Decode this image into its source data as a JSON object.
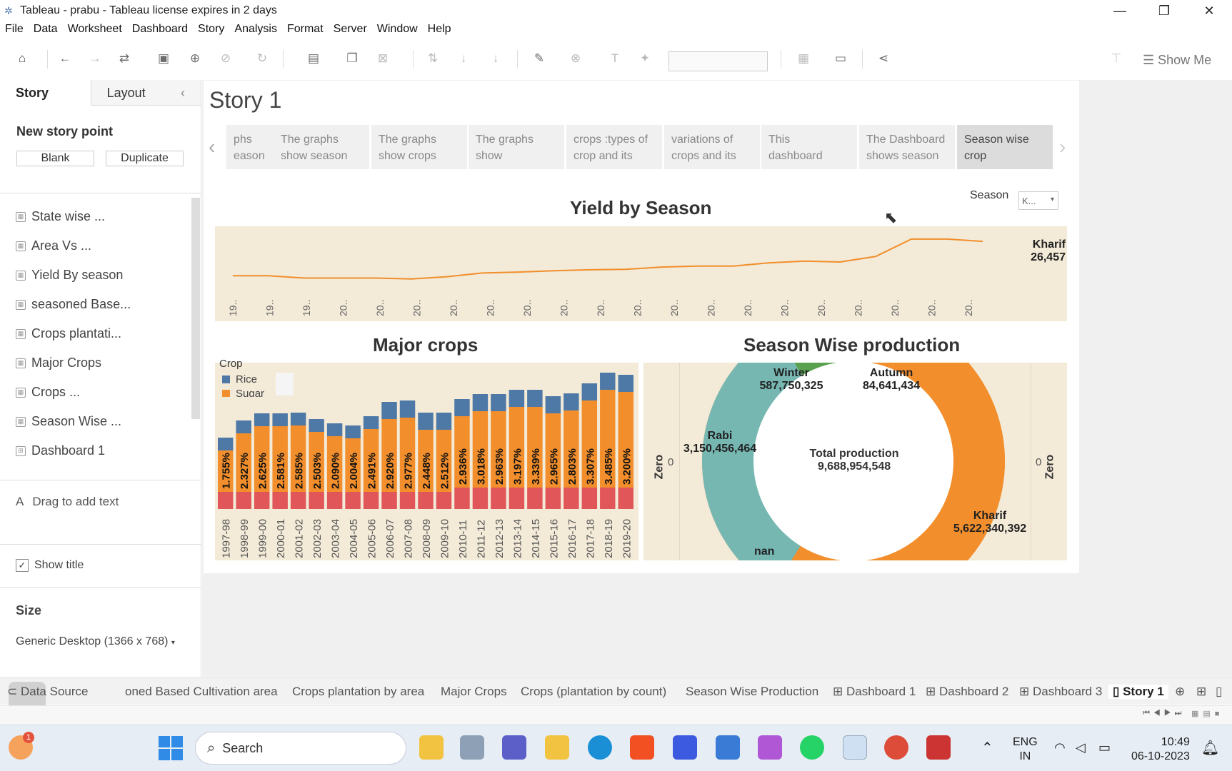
{
  "window": {
    "title": "Tableau - prabu - Tableau license expires in 2 days"
  },
  "menu": [
    "File",
    "Data",
    "Worksheet",
    "Dashboard",
    "Story",
    "Analysis",
    "Format",
    "Server",
    "Window",
    "Help"
  ],
  "toolbar": {
    "show_me": "Show Me"
  },
  "left_pane": {
    "tab_story": "Story",
    "tab_layout": "Layout",
    "new_story_point": "New story point",
    "blank": "Blank",
    "duplicate": "Duplicate",
    "sheets": [
      "State wise ...",
      "Area Vs ...",
      "Yield By season",
      "seasoned Base...",
      "Crops plantati...",
      "Major Crops",
      "Crops ...",
      "Season Wise ...",
      "Dashboard 1"
    ],
    "drag_text": "Drag to add text",
    "show_title": "Show title",
    "size_label": "Size",
    "size_value": "Generic Desktop (1366 x 768)"
  },
  "story": {
    "title": "Story 1",
    "points": [
      [
        "phs",
        "eason"
      ],
      [
        "The graphs",
        "show season"
      ],
      [
        "The graphs",
        "show crops"
      ],
      [
        "The graphs",
        "show"
      ],
      [
        "crops :types of",
        "crop and its"
      ],
      [
        "variations of",
        "crops and its"
      ],
      [
        "This",
        "dashboard"
      ],
      [
        "The Dashboard",
        "shows season"
      ],
      [
        "Season wise",
        "crop"
      ]
    ]
  },
  "filter": {
    "label": "Season",
    "value": "K..."
  },
  "yield_chart": {
    "title": "Yield by Season",
    "end_label_name": "Kharif",
    "end_label_value": "26,457",
    "x_ticks": [
      "19..",
      "19..",
      "19..",
      "20..",
      "20..",
      "20..",
      "20..",
      "20..",
      "20..",
      "20..",
      "20..",
      "20..",
      "20..",
      "20..",
      "20..",
      "20..",
      "20..",
      "20..",
      "20..",
      "20..",
      "20.."
    ]
  },
  "crops_chart": {
    "title": "Major crops",
    "legend_title": "Crop",
    "legend": [
      "Rice",
      "Sugar"
    ]
  },
  "pie_chart": {
    "title": "Season Wise production",
    "axis_label": "Zero",
    "axis_zero": "0",
    "center_title": "Total production",
    "center_value": "9,688,954,548",
    "labels": [
      {
        "name": "Winter",
        "value": "587,750,325"
      },
      {
        "name": "Autumn",
        "value": "84,641,434"
      },
      {
        "name": "Rabi",
        "value": "3,150,456,464"
      },
      {
        "name": "Kharif",
        "value": "5,622,340,392"
      },
      {
        "name": "nan",
        "value": ""
      }
    ]
  },
  "chart_data": [
    {
      "type": "line",
      "title": "Yield by Season",
      "series": [
        {
          "name": "Kharif",
          "values": [
            24400,
            24400,
            24350,
            24350,
            24350,
            24330,
            24380,
            24460,
            24480,
            24510,
            24530,
            24540,
            24590,
            24610,
            24610,
            24680,
            24720,
            24700,
            24820,
            25200,
            25200,
            25150
          ]
        }
      ],
      "end_value": 26457
    },
    {
      "type": "bar",
      "title": "Major crops",
      "categories": [
        "1997-98",
        "1998-99",
        "1999-00",
        "2000-01",
        "2001-02",
        "2002-03",
        "2003-04",
        "2004-05",
        "2005-06",
        "2006-07",
        "2007-08",
        "2008-09",
        "2009-10",
        "2010-11",
        "2011-12",
        "2012-13",
        "2013-14",
        "2014-15",
        "2015-16",
        "2016-17",
        "2017-18",
        "2018-19",
        "2019-20"
      ],
      "series": [
        {
          "name": "Sugar",
          "labels": [
            "1.755%",
            "2.327%",
            "2.625%",
            "2.581%",
            "2.585%",
            "2.503%",
            "2.090%",
            "2.004%",
            "2.491%",
            "2.920%",
            "2.977%",
            "2.448%",
            "2.512%",
            "2.936%",
            "3.018%",
            "2.963%",
            "3.197%",
            "3.339%",
            "2.965%",
            "2.803%",
            "3.307%",
            "3.485%",
            "3.200%"
          ]
        }
      ],
      "bar_totals": [
        100,
        124,
        134,
        134,
        135,
        126,
        120,
        117,
        130,
        150,
        152,
        135,
        135,
        154,
        161,
        161,
        167,
        167,
        158,
        162,
        176,
        191,
        188
      ]
    },
    {
      "type": "pie",
      "title": "Season Wise production",
      "slices": [
        {
          "name": "Kharif",
          "value": 5622340392
        },
        {
          "name": "Rabi",
          "value": 3150456464
        },
        {
          "name": "Winter",
          "value": 587750325
        },
        {
          "name": "Autumn",
          "value": 84641434
        }
      ],
      "total": 9688954548
    }
  ],
  "bottom_tabs": [
    "Data Source",
    "oned Based Cultivation area",
    "Crops plantation by area",
    "Major Crops",
    "Crops (plantation by count)",
    "Season Wise Production",
    "Dashboard 1",
    "Dashboard 2",
    "Dashboard 3",
    "Story 1"
  ],
  "taskbar": {
    "search": "Search",
    "lang1": "ENG",
    "lang2": "IN",
    "time": "10:49",
    "date": "06-10-2023"
  }
}
